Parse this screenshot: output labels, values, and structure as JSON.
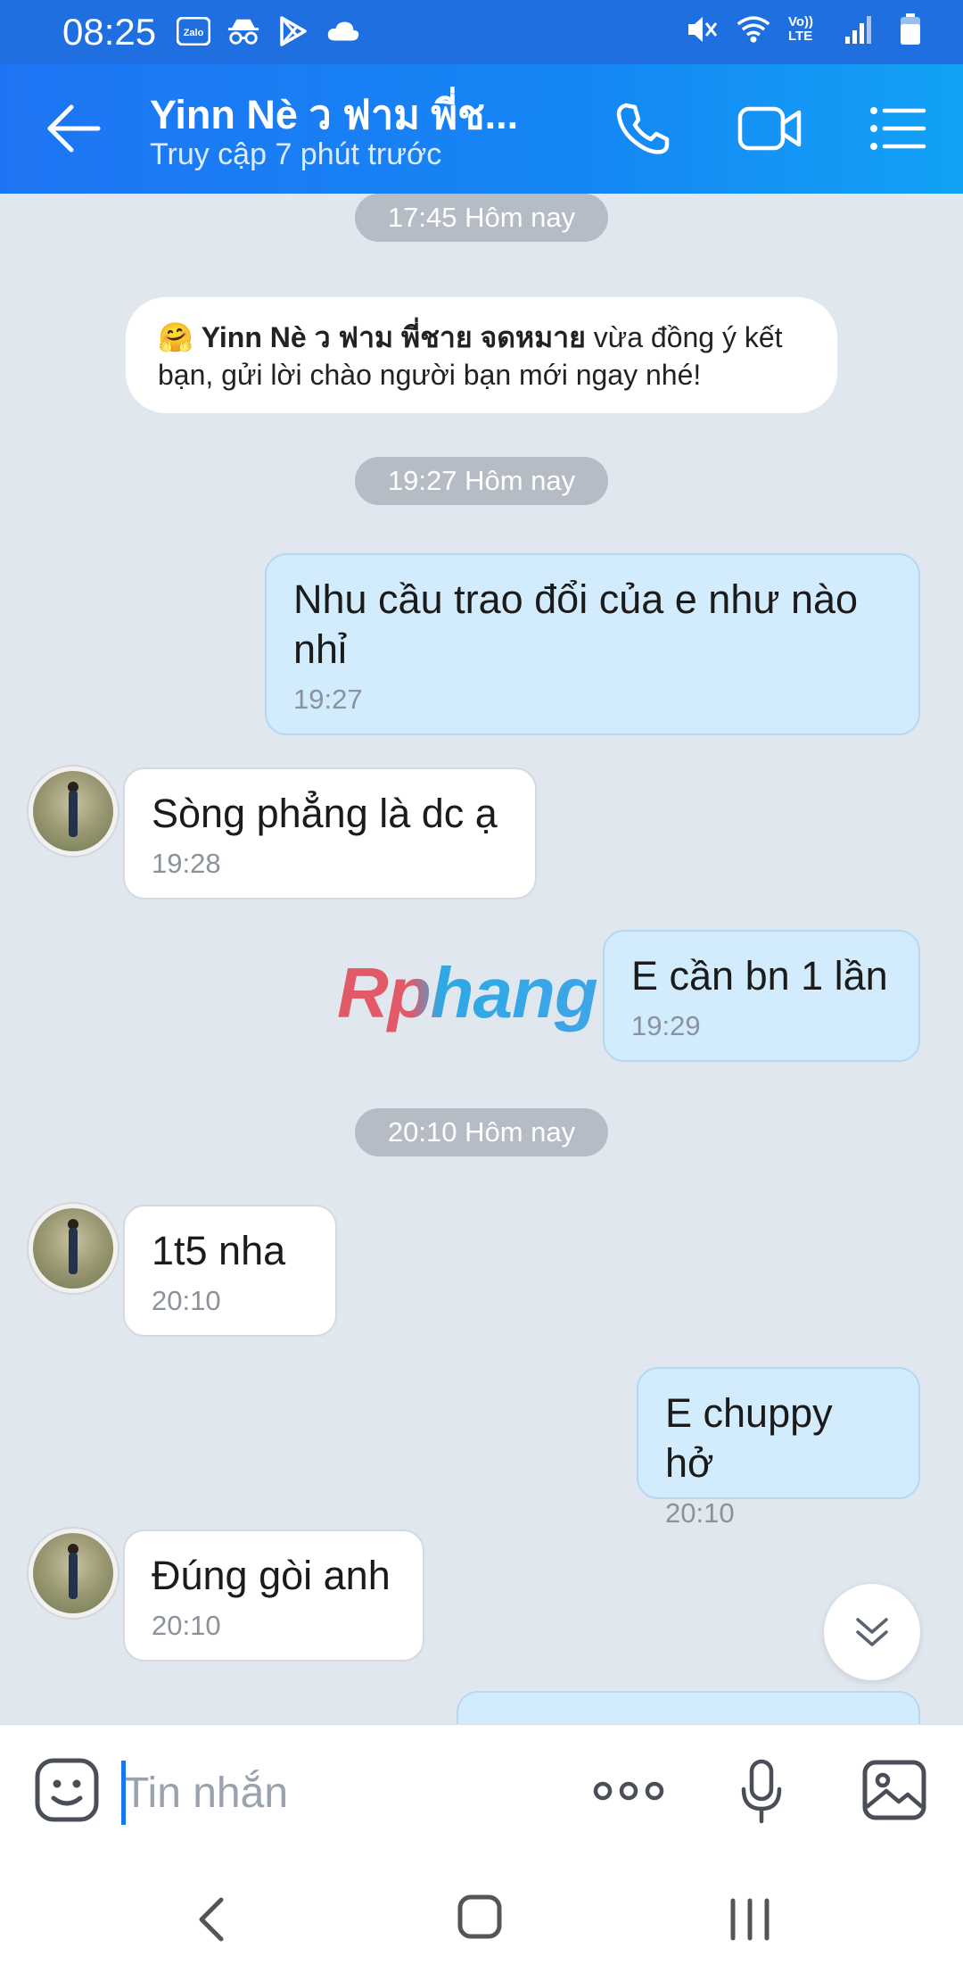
{
  "status_bar": {
    "time": "08:25",
    "left_icons": [
      "zalo-icon",
      "incognito-icon",
      "play-store-icon",
      "cloud-icon"
    ],
    "right_icons": [
      "mute-icon",
      "wifi-icon",
      "volte-icon",
      "signal-icon",
      "battery-icon"
    ],
    "volte_label": "Vo)) LTE"
  },
  "header": {
    "title": "Yinn Nè ว ฟาม พี่ช...",
    "subtitle": "Truy cập 7 phút trước",
    "colors": {
      "start": "#1e75f3",
      "end": "#12a2f5"
    }
  },
  "chat": {
    "timestamps": [
      "17:45 Hôm nay",
      "19:27 Hôm nay",
      "20:10 Hôm nay"
    ],
    "system_message": {
      "emoji": "🤗",
      "name": "Yinn Nè ว ฟาม พี่ชาย จดหมาย",
      "text": " vừa đồng ý kết bạn, gửi lời chào người bạn mới ngay nhé!"
    },
    "messages": [
      {
        "direction": "out",
        "text": "Nhu cầu trao đổi của e như nào nhỉ",
        "time": "19:27"
      },
      {
        "direction": "in",
        "text": "Sòng phẳng là dc ạ",
        "time": "19:28"
      },
      {
        "direction": "out",
        "text": "E cần bn 1 lần",
        "time": "19:29"
      },
      {
        "direction": "in",
        "text": "1t5 nha",
        "time": "20:10"
      },
      {
        "direction": "out",
        "text": "E chuppy hở",
        "time": "20:10"
      },
      {
        "direction": "in",
        "text": "Đúng gòi anh",
        "time": "20:10"
      }
    ],
    "watermark": "Rphang"
  },
  "input": {
    "placeholder": "Tin nhắn",
    "value": ""
  },
  "colors": {
    "outgoing_bubble": "#d3ecfd",
    "incoming_bubble": "#ffffff",
    "chat_background": "#e1e7ef"
  }
}
